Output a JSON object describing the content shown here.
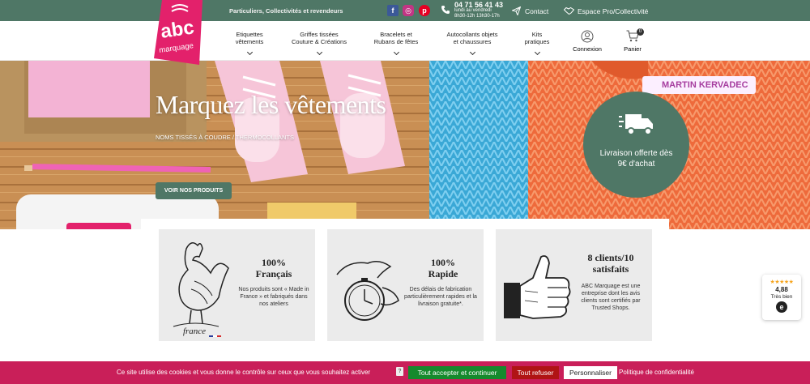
{
  "topbar": {
    "tagline": "Particuliers, Collectivités et revendeurs",
    "phone": "04 71 56 41 43",
    "hours_line1": "lundi au vendredi",
    "hours_line2": "8h30-12h 13h30-17h",
    "contact_label": "Contact",
    "pro_label": "Espace Pro/Collectivité",
    "social_icons": [
      "facebook-icon",
      "instagram-icon",
      "pinterest-icon"
    ]
  },
  "logo": {
    "brand": "abc",
    "sub": "marquage"
  },
  "nav": {
    "items": [
      {
        "line1": "Etiquettes",
        "line2": "vêtements"
      },
      {
        "line1": "Griffes tissées",
        "line2": "Couture & Créations"
      },
      {
        "line1": "Bracelets et",
        "line2": "Rubans de fêtes"
      },
      {
        "line1": "Autocollants objets",
        "line2": "et chaussures"
      },
      {
        "line1": "Kits",
        "line2": "pratiques"
      }
    ],
    "account_label": "Connexion",
    "cart_label": "Panier",
    "cart_count": "0"
  },
  "hero": {
    "title": "Marquez les vêtements",
    "subtitle": "NOMS TISSÉS À COUDRE / THERMOCOLLANTS",
    "cta": "VOIR NOS PRODUITS",
    "delivery_line1": "Livraison offerte dès",
    "delivery_line2": "9€ d'achat",
    "label_tag": "MARTIN KERVADEC"
  },
  "features": [
    {
      "title1": "100%",
      "title2": "Français",
      "desc": "Nos produits sont « Made in France » et fabriqués dans nos ateliers",
      "icon": "rooster-icon",
      "extra": "france"
    },
    {
      "title1": "100%",
      "title2": "Rapide",
      "desc": "Des délais de fabrication particulièrement rapides et la livraison gratuite*.",
      "icon": "stopwatch-icon"
    },
    {
      "title1": "8 clients/10",
      "title2": "satisfaits",
      "desc": "ABC Marquage est une entreprise dont les avis clients sont certifiés par Trusted Shops.",
      "icon": "thumbs-up-icon"
    }
  ],
  "trusted": {
    "stars": "★★★★★",
    "score": "4,88",
    "label": "Très bien",
    "seal": "e"
  },
  "cookie": {
    "message": "Ce site utilise des cookies et vous donne le contrôle sur ceux que vous souhaitez activer",
    "help": "?",
    "accept": "Tout accepter et continuer",
    "refuse": "Tout refuser",
    "customize": "Personnaliser",
    "policy": "Politique de confidentialité"
  },
  "colors": {
    "brand_green": "#4f7766",
    "brand_pink": "#e3216b",
    "cookie_bar": "#c91f59",
    "accept_green": "#158a2d",
    "refuse_red": "#b01414"
  }
}
